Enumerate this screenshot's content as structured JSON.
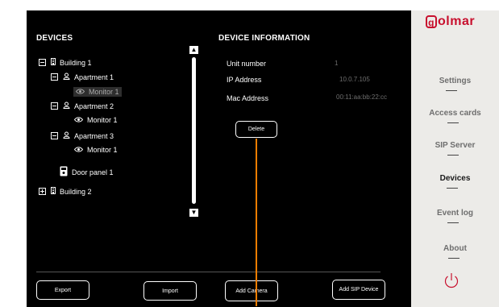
{
  "sections": {
    "devices_title": "DEVICES",
    "info_title": "DEVICE INFORMATION"
  },
  "tree": [
    {
      "label": "Building 1",
      "expander": "minus",
      "icon": "building-icon"
    },
    {
      "label": "Apartment 1",
      "expander": "minus",
      "icon": "person-icon"
    },
    {
      "label": "Monitor 1",
      "expander": "",
      "icon": "eye-icon",
      "selected": true
    },
    {
      "label": "Apartment 2",
      "expander": "minus",
      "icon": "person-icon"
    },
    {
      "label": "Monitor 1",
      "expander": "",
      "icon": "eye-icon"
    },
    {
      "label": "Apartment 3",
      "expander": "minus",
      "icon": "person-icon"
    },
    {
      "label": "Monitor 1",
      "expander": "",
      "icon": "eye-icon"
    },
    {
      "label": "Door panel 1",
      "expander": "",
      "icon": "door-panel-icon"
    },
    {
      "label": "Building 2",
      "expander": "plus",
      "icon": "building-icon"
    }
  ],
  "info": {
    "unit_label": "Unit number",
    "unit_value": "1",
    "ip_label": "IP Address",
    "ip_value": "10.0.7.105",
    "mac_label": "Mac Address",
    "mac_value": "00:11:aa:bb:22:cc",
    "delete_label": "Delete"
  },
  "footer": {
    "export": "Export",
    "import": "Import",
    "add_camera": "Add Camera",
    "add_sip": "Add SIP Device"
  },
  "brand": {
    "logo_text": "olmar",
    "logo_letter": "g",
    "color": "#c8102e"
  },
  "menu": [
    {
      "label": "Settings",
      "active": false
    },
    {
      "label": "Access cards",
      "active": false
    },
    {
      "label": "SIP Server",
      "active": false
    },
    {
      "label": "Devices",
      "active": true
    },
    {
      "label": "Event log",
      "active": false
    },
    {
      "label": "About",
      "active": false
    }
  ],
  "colors": {
    "accent_line": "#f07d00",
    "power": "#c8102e"
  }
}
